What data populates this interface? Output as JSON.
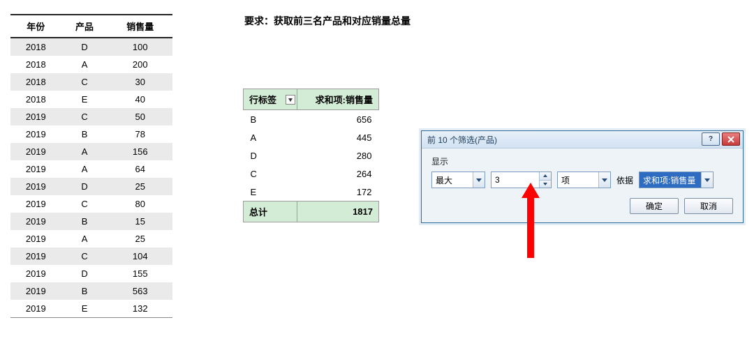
{
  "instruction": "要求：获取前三名产品和对应销量总量",
  "data_table": {
    "headers": [
      "年份",
      "产品",
      "销售量"
    ],
    "rows": [
      [
        "2018",
        "D",
        "100"
      ],
      [
        "2018",
        "A",
        "200"
      ],
      [
        "2018",
        "C",
        "30"
      ],
      [
        "2018",
        "E",
        "40"
      ],
      [
        "2019",
        "C",
        "50"
      ],
      [
        "2019",
        "B",
        "78"
      ],
      [
        "2019",
        "A",
        "156"
      ],
      [
        "2019",
        "A",
        "64"
      ],
      [
        "2019",
        "D",
        "25"
      ],
      [
        "2019",
        "C",
        "80"
      ],
      [
        "2019",
        "B",
        "15"
      ],
      [
        "2019",
        "A",
        "25"
      ],
      [
        "2019",
        "C",
        "104"
      ],
      [
        "2019",
        "D",
        "155"
      ],
      [
        "2019",
        "B",
        "563"
      ],
      [
        "2019",
        "E",
        "132"
      ]
    ]
  },
  "pivot": {
    "row_label_header": "行标签",
    "value_header": "求和项:销售量",
    "rows": [
      {
        "label": "B",
        "value": "656"
      },
      {
        "label": "A",
        "value": "445"
      },
      {
        "label": "D",
        "value": "280"
      },
      {
        "label": "C",
        "value": "264"
      },
      {
        "label": "E",
        "value": "172"
      }
    ],
    "total_label": "总计",
    "total_value": "1817"
  },
  "dialog": {
    "title": "前 10 个筛选(产品)",
    "show_label": "显示",
    "direction_value": "最大",
    "count_value": "3",
    "unit_value": "项",
    "by_label": "依据",
    "by_value": "求和项:销售量",
    "ok": "确定",
    "cancel": "取消"
  }
}
